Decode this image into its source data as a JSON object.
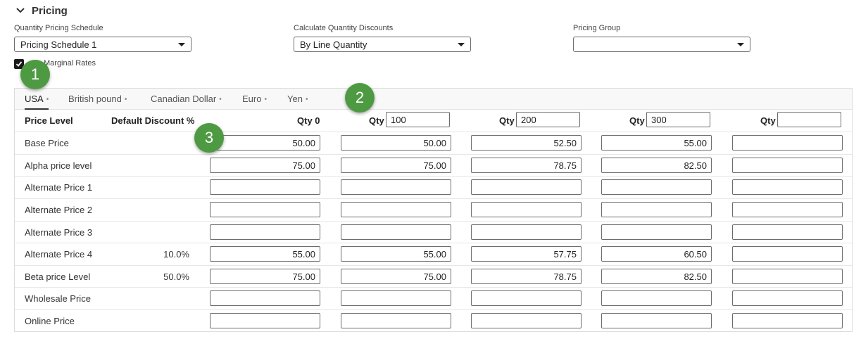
{
  "section": {
    "title": "Pricing"
  },
  "fields": {
    "schedule": {
      "label": "Quantity Pricing Schedule",
      "value": "Pricing Schedule 1"
    },
    "discounts": {
      "label": "Calculate Quantity Discounts",
      "value": "By Line Quantity"
    },
    "group": {
      "label": "Pricing Group",
      "value": ""
    }
  },
  "marginal": {
    "label": "Marginal Rates",
    "checked": true
  },
  "tabs": [
    "USA",
    "British pound",
    "Canadian Dollar",
    "Euro",
    "Yen"
  ],
  "headers": {
    "price_level": "Price Level",
    "default_discount": "Default Discount %",
    "qty": "Qty",
    "qty0": "Qty 0"
  },
  "qty_values": [
    "100",
    "200",
    "300",
    ""
  ],
  "rows": [
    {
      "label": "Base Price",
      "discount": "",
      "prices": [
        "50.00",
        "50.00",
        "52.50",
        "55.00",
        ""
      ]
    },
    {
      "label": "Alpha price level",
      "discount": "",
      "prices": [
        "75.00",
        "75.00",
        "78.75",
        "82.50",
        ""
      ]
    },
    {
      "label": "Alternate Price 1",
      "discount": "",
      "prices": [
        "",
        "",
        "",
        "",
        ""
      ]
    },
    {
      "label": "Alternate Price 2",
      "discount": "",
      "prices": [
        "",
        "",
        "",
        "",
        ""
      ]
    },
    {
      "label": "Alternate Price 3",
      "discount": "",
      "prices": [
        "",
        "",
        "",
        "",
        ""
      ]
    },
    {
      "label": "Alternate Price 4",
      "discount": "10.0%",
      "prices": [
        "55.00",
        "55.00",
        "57.75",
        "60.50",
        ""
      ]
    },
    {
      "label": "Beta price Level",
      "discount": "50.0%",
      "prices": [
        "75.00",
        "75.00",
        "78.75",
        "82.50",
        ""
      ]
    },
    {
      "label": "Wholesale Price",
      "discount": "",
      "prices": [
        "",
        "",
        "",
        "",
        ""
      ]
    },
    {
      "label": "Online Price",
      "discount": "",
      "prices": [
        "",
        "",
        "",
        "",
        ""
      ]
    }
  ],
  "markers": [
    "1",
    "2",
    "3"
  ],
  "colors": {
    "marker": "#4e9a42"
  }
}
